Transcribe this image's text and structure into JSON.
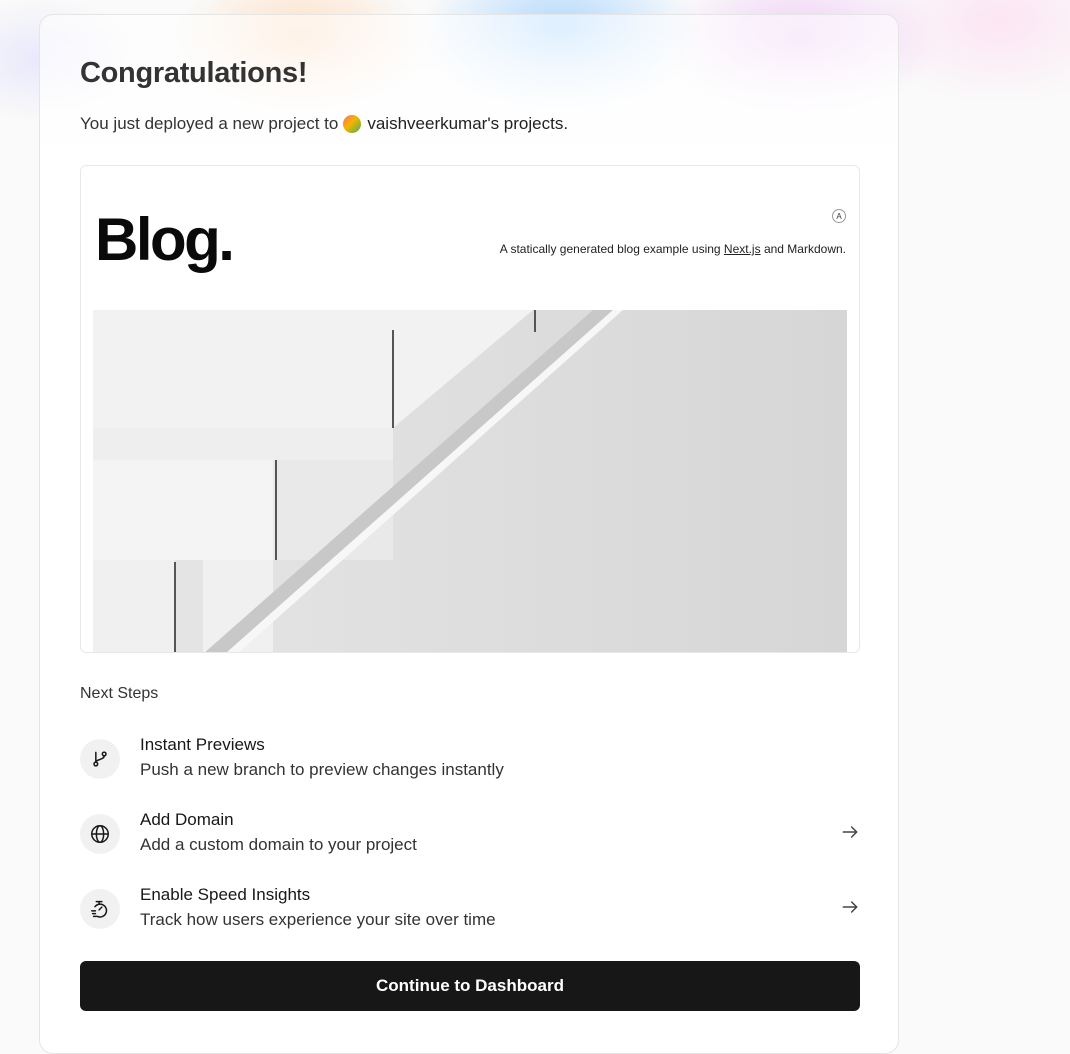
{
  "header": {
    "title": "Congratulations!",
    "subtitle_prefix": "You just deployed a new project to",
    "team_name": "vaishveerkumar's projects."
  },
  "preview": {
    "blog_title": "Blog.",
    "description_prefix": "A statically generated blog example using ",
    "description_link": "Next.js",
    "description_suffix": " and Markdown.",
    "badge": "A"
  },
  "next_steps": {
    "label": "Next Steps",
    "items": [
      {
        "title": "Instant Previews",
        "description": "Push a new branch to preview changes instantly",
        "icon": "git-branch-icon"
      },
      {
        "title": "Add Domain",
        "description": "Add a custom domain to your project",
        "icon": "globe-icon"
      },
      {
        "title": "Enable Speed Insights",
        "description": "Track how users experience your site over time",
        "icon": "speed-gauge-icon"
      }
    ]
  },
  "cta": {
    "label": "Continue to Dashboard"
  }
}
